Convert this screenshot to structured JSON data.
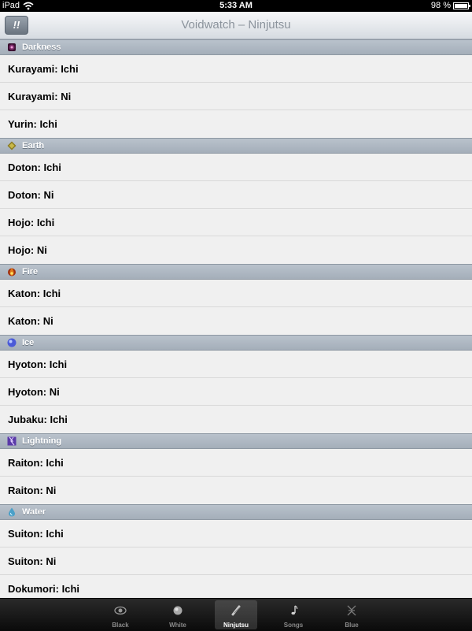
{
  "status_bar": {
    "device": "iPad",
    "time": "5:33 AM",
    "battery": "98 %",
    "battery_level": 0.98
  },
  "nav": {
    "button_label": "!!",
    "title": "Voidwatch – Ninjutsu"
  },
  "sections": [
    {
      "label": "Darkness",
      "icon": "darkness-icon",
      "color": "#7a2a6a",
      "items": [
        "Kurayami: Ichi",
        "Kurayami: Ni",
        "Yurin: Ichi"
      ]
    },
    {
      "label": "Earth",
      "icon": "earth-icon",
      "color": "#8a7a20",
      "items": [
        "Doton: Ichi",
        "Doton: Ni",
        "Hojo: Ichi",
        "Hojo: Ni"
      ]
    },
    {
      "label": "Fire",
      "icon": "fire-icon",
      "color": "#e07818",
      "items": [
        "Katon: Ichi",
        "Katon: Ni"
      ]
    },
    {
      "label": "Ice",
      "icon": "ice-icon",
      "color": "#4a5ad8",
      "items": [
        "Hyoton: Ichi",
        "Hyoton: Ni",
        "Jubaku: Ichi"
      ]
    },
    {
      "label": "Lightning",
      "icon": "lightning-icon",
      "color": "#5a3aa8",
      "items": [
        "Raiton: Ichi",
        "Raiton: Ni"
      ]
    },
    {
      "label": "Water",
      "icon": "water-icon",
      "color": "#4aa0c8",
      "items": [
        "Suiton: Ichi",
        "Suiton: Ni",
        "Dokumori: Ichi"
      ]
    }
  ],
  "tabs": [
    {
      "label": "Black",
      "icon": "eye-icon",
      "selected": false
    },
    {
      "label": "White",
      "icon": "orb-icon",
      "selected": false
    },
    {
      "label": "Ninjutsu",
      "icon": "scroll-icon",
      "selected": true
    },
    {
      "label": "Songs",
      "icon": "music-note-icon",
      "selected": false
    },
    {
      "label": "Blue",
      "icon": "blue-magic-icon",
      "selected": false
    }
  ]
}
